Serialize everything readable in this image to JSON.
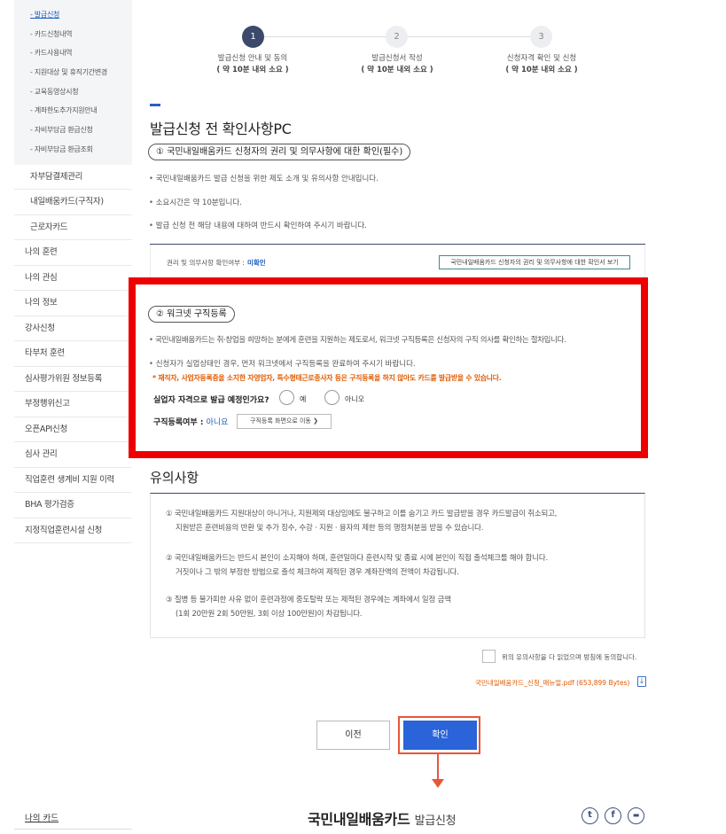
{
  "sidebar": {
    "sub_items": [
      {
        "label": "- 발급신청",
        "active": true
      },
      {
        "label": "- 카드신청내역"
      },
      {
        "label": "- 카드사용내역"
      },
      {
        "label": "- 지원대상 및 휴직기간변경"
      },
      {
        "label": "- 교육동영상시청"
      },
      {
        "label": "- 계좌한도추가지원안내"
      },
      {
        "label": "- 자비부담금 환급신청"
      },
      {
        "label": "- 자비부담금 환급조회"
      }
    ],
    "level2_items": [
      "자부담결제관리",
      "내일배움카드(구직자)",
      "근로자카드"
    ],
    "level1_items": [
      "나의 훈련",
      "나의 관심",
      "나의 정보",
      "강사신청",
      "타부처 훈련",
      "심사평가위원 정보등록",
      "부정행위신고",
      "오픈API신청",
      "심사 관리",
      "직업훈련 생계비 지원 이력",
      "BHA 평가검증",
      "지정직업훈련시설 신청"
    ]
  },
  "steps": [
    {
      "number": "1",
      "label": "발급신청 안내 및 동의",
      "time": "( 약 10분 내외 소요 )"
    },
    {
      "number": "2",
      "label": "발급신청서 작성",
      "time": "( 약 10분 내외 소요 )"
    },
    {
      "number": "3",
      "label": "신청자격 확인 및 신청",
      "time": "( 약 10분 내외 소요 )"
    }
  ],
  "page_title": "발급신청 전 확인사항PC",
  "section1": {
    "heading": "① 국민내일배움카드 신청자의 권리 및 의무사항에 대한 확인(필수)",
    "bullets": [
      "국민내일배움카드 발급 신청을 위한 제도 소개 및 유의사항 안내입니다.",
      "소요시간은 약 10분입니다.",
      "발급 신청 전 해당 내용에 대하여 반드시 확인하여 주시기 바랍니다."
    ],
    "status_label": "권리 및 의무사항 확인여부 :",
    "status_value": "미확인",
    "view_button": "국민내일배움카드 신청자의 권리 및 의무사항에 대한 확인서 보기"
  },
  "section2": {
    "heading": "② 워크넷 구직등록",
    "bullets": [
      "국민내일배움카드는 취·창업을 희망하는 분에게 훈련을 지원하는 제도로서, 워크넷 구직등록은 신청자의 구직 의사를 확인하는 절차입니다.",
      "신청자가 실업상태인 경우, 먼저 워크넷에서 구직등록을 완료하여 주시기 바랍니다."
    ],
    "warning": "* 재직자, 사업자등록증을 소지한 자영업자, 특수형태근로종사자 등은 구직등록을 하지 않아도 카드를 발급받을 수 있습니다.",
    "question": "실업자 자격으로 발급 예정인가요?",
    "option_yes": "예",
    "option_no": "아니오",
    "reg_label": "구직등록여부 :",
    "reg_value": "아니요",
    "reg_button": "구직등록 화면으로 이동 ❯"
  },
  "notice": {
    "title": "유의사항",
    "items": [
      [
        "① 국민내일배움카드 지원대상이 아니거나, 지원제외 대상임에도 불구하고 이를 숨기고 카드 발급받을 경우 카드발급이 취소되고,",
        "지원받은 훈련비용의 반환 및 추가 징수, 수강 · 지원 · 융자의 제한 등의 행정처분을 받을 수 있습니다."
      ],
      [
        "② 국민내일배움카드는 반드시 본인이 소지해야 하며, 훈련일마다 훈련시작 및 종료 시에 본인이 직접 출석체크를 해야 합니다.",
        "거짓이나 그 밖의 부정한 방법으로 출석 체크하여 제적된 경우 계좌잔액의 전액이 차감됩니다."
      ],
      [
        "③ 질병 등 불가피한 사유 없이 훈련과정에 중도탈락 또는 제적된 경우에는 계좌에서 일정 금액",
        "(1회 20만원 2회 50만원, 3회 이상 100만원)이 차감됩니다."
      ]
    ]
  },
  "agree_label": "위의 유의사항을 다 읽었으며 방침에 동의합니다.",
  "pdf_link": "국민내일배움카드_신청_매뉴얼.pdf (653,899 Bytes)",
  "buttons": {
    "prev": "이전",
    "confirm": "확인"
  },
  "footer": {
    "my_card": "나의 카드",
    "title": "국민내일배움카드",
    "subtitle": "발급신청",
    "social": [
      {
        "name": "twitter-icon",
        "glyph": "t"
      },
      {
        "name": "facebook-icon",
        "glyph": "f"
      },
      {
        "name": "message-icon",
        "glyph": "▬"
      }
    ]
  },
  "colors": {
    "accent": "#2b63d8",
    "highlight_red": "#ee0000",
    "warning_orange": "#e05a00",
    "step_active": "#3b4a6b"
  }
}
